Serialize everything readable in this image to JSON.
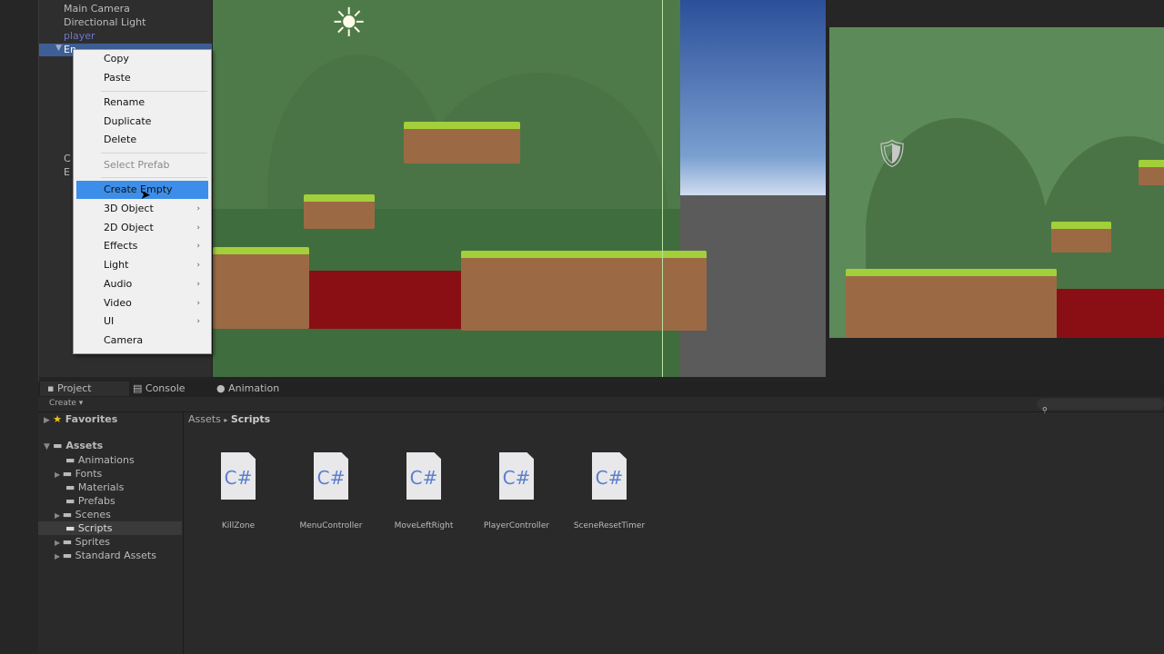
{
  "hierarchy": {
    "items": [
      "Main Camera",
      "Directional Light",
      "player",
      "En"
    ],
    "partial": [
      "C",
      "E"
    ]
  },
  "context_menu": {
    "items": [
      {
        "label": "Copy"
      },
      {
        "label": "Paste"
      },
      {
        "label": "Rename"
      },
      {
        "label": "Duplicate"
      },
      {
        "label": "Delete"
      },
      {
        "label": "Select Prefab",
        "disabled": true
      },
      {
        "label": "Create Empty",
        "highlighted": true
      },
      {
        "label": "3D Object",
        "submenu": true
      },
      {
        "label": "2D Object",
        "submenu": true
      },
      {
        "label": "Effects",
        "submenu": true
      },
      {
        "label": "Light",
        "submenu": true
      },
      {
        "label": "Audio",
        "submenu": true
      },
      {
        "label": "Video",
        "submenu": true
      },
      {
        "label": "UI",
        "submenu": true
      },
      {
        "label": "Camera"
      }
    ]
  },
  "bottom_tabs": [
    "Project",
    "Console",
    "Animation"
  ],
  "project": {
    "create_label": "Create ▾",
    "favorites": "Favorites",
    "assets": "Assets",
    "folders": [
      "Animations",
      "Fonts",
      "Materials",
      "Prefabs",
      "Scenes",
      "Scripts",
      "Sprites",
      "Standard Assets"
    ],
    "selected_folder": "Scripts",
    "breadcrumb": [
      "Assets",
      "Scripts"
    ],
    "files": [
      "KillZone",
      "MenuController",
      "MoveLeftRight",
      "PlayerController",
      "SceneResetTimer"
    ],
    "file_icon_text": "C#"
  },
  "colors": {
    "highlight": "#3d8ee8",
    "selection": "#3e5f96"
  }
}
